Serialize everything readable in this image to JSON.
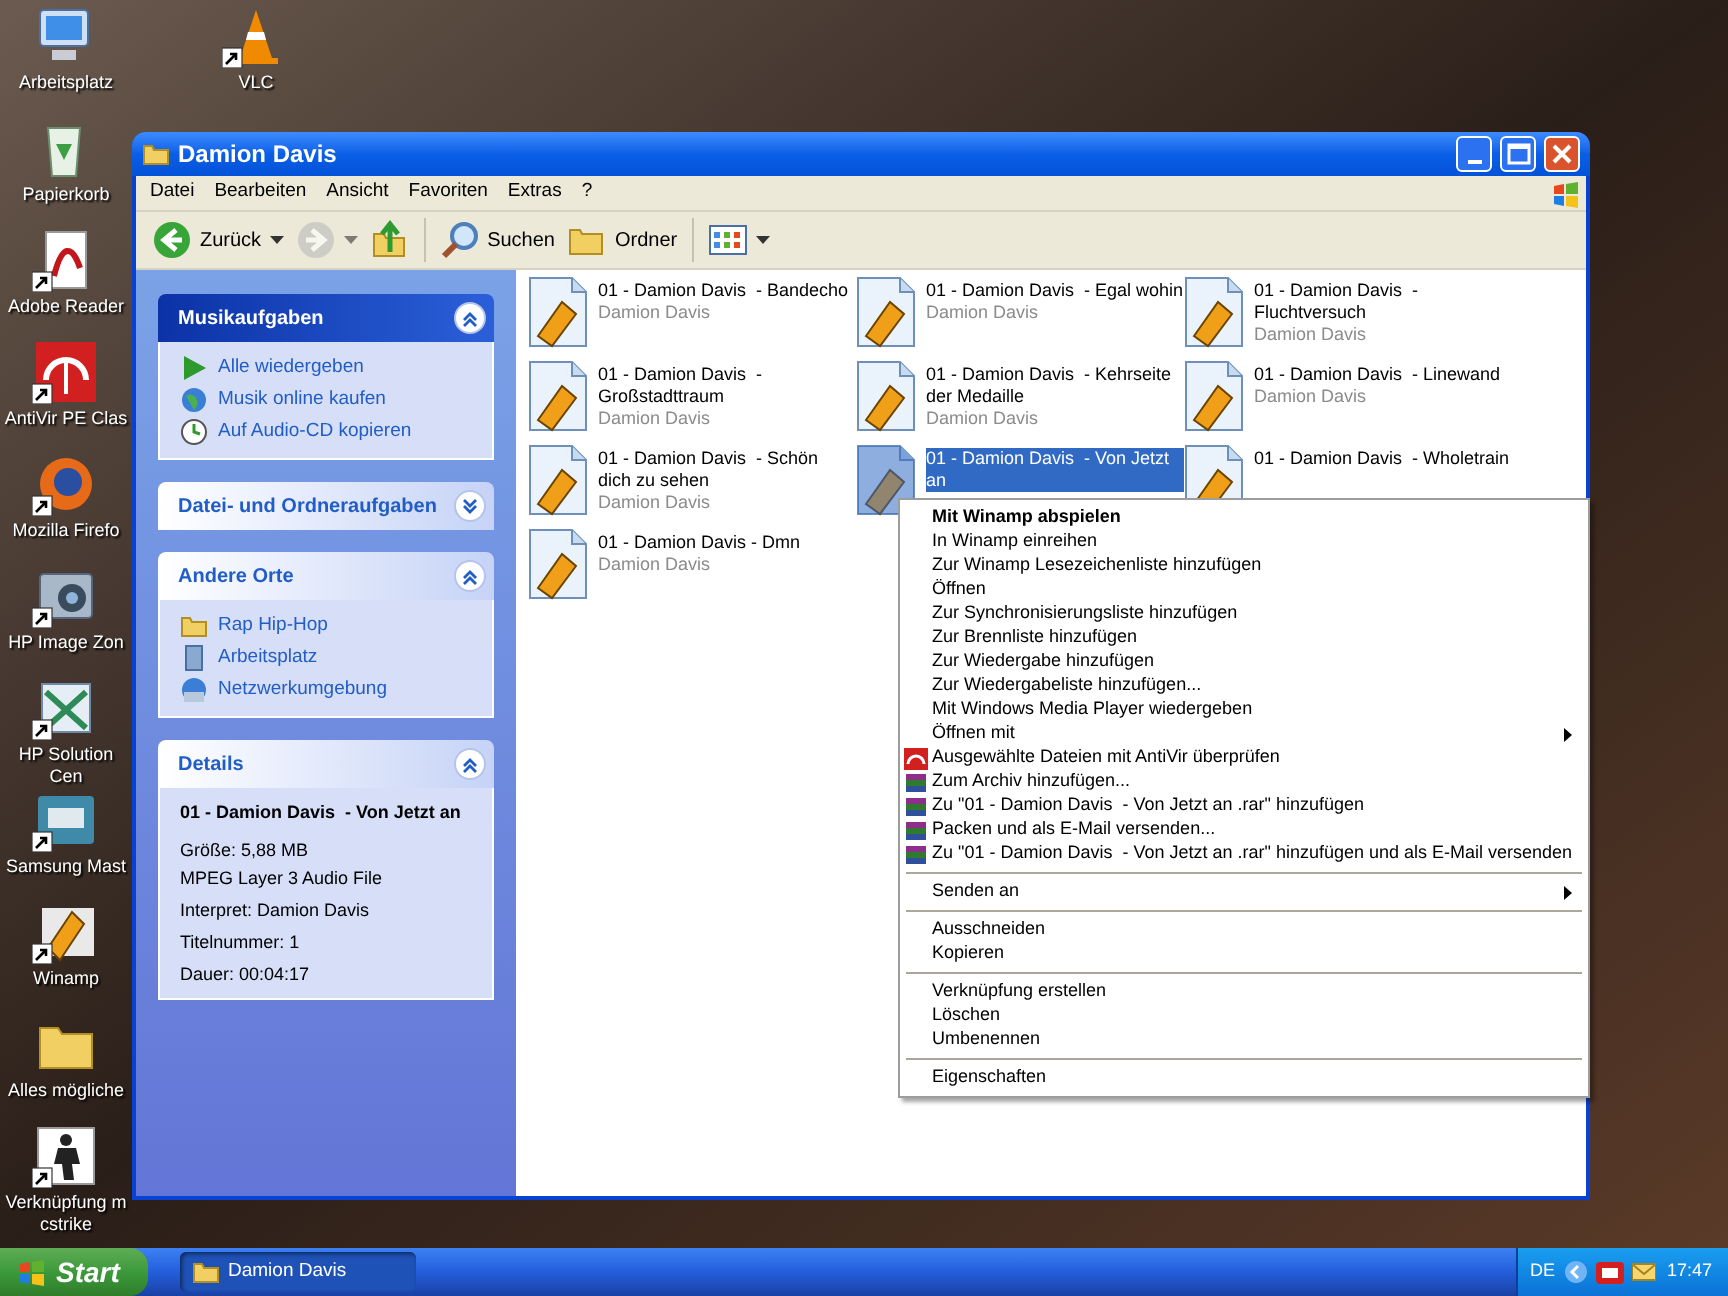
{
  "desktop": {
    "column_1": [
      {
        "label": "Arbeitsplatz",
        "kind": "computer",
        "shortcut": false
      },
      {
        "label": "Papierkorb",
        "kind": "recycle",
        "shortcut": false
      },
      {
        "label": "Adobe Reader",
        "kind": "pdf",
        "shortcut": true
      },
      {
        "label": "AntiVir PE Clas",
        "kind": "antivir",
        "shortcut": true
      },
      {
        "label": "Mozilla Firefo",
        "kind": "firefox",
        "shortcut": true
      },
      {
        "label": "HP Image Zon",
        "kind": "camera",
        "shortcut": true
      },
      {
        "label": "HP Solution Cen",
        "kind": "hp",
        "shortcut": true
      },
      {
        "label": "Samsung Mast",
        "kind": "samsung",
        "shortcut": true
      },
      {
        "label": "Winamp",
        "kind": "winamp",
        "shortcut": true
      },
      {
        "label": "Alles mögliche",
        "kind": "folder",
        "shortcut": false
      },
      {
        "label": "Verknüpfung m cstrike",
        "kind": "game",
        "shortcut": true
      }
    ],
    "column_2": [
      {
        "label": "VLC",
        "kind": "vlc",
        "shortcut": true
      }
    ]
  },
  "window": {
    "title": "Damion Davis",
    "menu": [
      "Datei",
      "Bearbeiten",
      "Ansicht",
      "Favoriten",
      "Extras",
      "?"
    ],
    "toolbar": [
      {
        "label": "Zurück",
        "kind": "back",
        "disabled": false
      },
      {
        "kind": "forward",
        "disabled": true
      },
      {
        "kind": "up",
        "disabled": false
      },
      {
        "label": "Suchen",
        "kind": "search",
        "disabled": false
      },
      {
        "label": "Ordner",
        "kind": "folders",
        "disabled": false
      },
      {
        "kind": "views",
        "disabled": false
      }
    ],
    "task_panels": [
      {
        "title": "Musikaufgaben",
        "kind": "special",
        "expanded": true,
        "links": [
          {
            "label": "Alle wiedergeben",
            "kind": "play"
          },
          {
            "label": "Musik online kaufen",
            "kind": "globe"
          },
          {
            "label": "Auf Audio-CD kopieren",
            "kind": "cd"
          }
        ]
      },
      {
        "title": "Datei- und Ordneraufgaben",
        "kind": "normal",
        "expanded": false
      },
      {
        "title": "Andere Orte",
        "kind": "normal",
        "expanded": true,
        "links": [
          {
            "label": "Rap Hip-Hop",
            "kind": "folder"
          },
          {
            "label": "Arbeitsplatz",
            "kind": "computer"
          },
          {
            "label": "Netzwerkumgebung",
            "kind": "network"
          }
        ]
      },
      {
        "title": "Details",
        "kind": "normal",
        "expanded": true,
        "details": {
          "name": "01 - Damion Davis  - Von Jetzt an",
          "lines": [
            "Größe: 5,88 MB",
            "MPEG Layer 3 Audio File",
            "Interpret: Damion Davis",
            "Titelnummer: 1",
            "Dauer: 00:04:17"
          ]
        }
      }
    ],
    "files": [
      {
        "name": "01 - Damion Davis  - Bandecho",
        "artist": "Damion Davis",
        "selected": false
      },
      {
        "name": "01 - Damion Davis  - Egal wohin",
        "artist": "Damion Davis",
        "selected": false
      },
      {
        "name": "01 - Damion Davis  - Fluchtversuch",
        "artist": "Damion Davis",
        "selected": false
      },
      {
        "name": "01 - Damion Davis  - Großstadttraum",
        "artist": "Damion Davis",
        "selected": false
      },
      {
        "name": "01 - Damion Davis  - Kehrseite der Medaille",
        "artist": "Damion Davis",
        "selected": false
      },
      {
        "name": "01 - Damion Davis  - Linewand",
        "artist": "Damion Davis",
        "selected": false
      },
      {
        "name": "01 - Damion Davis  - Schön dich zu sehen",
        "artist": "Damion Davis",
        "selected": false
      },
      {
        "name": "01 - Damion Davis  - Von Jetzt an",
        "selected": true
      },
      {
        "name": "01 - Damion Davis  - Wholetrain",
        "selected": false
      },
      {
        "name": "01 - Damion Davis - Dmn",
        "artist": "Damion Davis",
        "selected": false
      }
    ]
  },
  "context_menu": {
    "groups": [
      [
        {
          "label": "Mit Winamp abspielen",
          "kind": "default"
        },
        {
          "label": "In Winamp einreihen",
          "kind": "plain"
        },
        {
          "label": "Zur Winamp Lesezeichenliste hinzufügen",
          "kind": "plain"
        },
        {
          "label": "Öffnen",
          "kind": "plain"
        },
        {
          "label": "Zur Synchronisierungsliste hinzufügen",
          "kind": "plain"
        },
        {
          "label": "Zur Brennliste hinzufügen",
          "kind": "plain"
        },
        {
          "label": "Zur Wiedergabe hinzufügen",
          "kind": "plain"
        },
        {
          "label": "Zur Wiedergabeliste hinzufügen...",
          "kind": "plain"
        },
        {
          "label": "Mit Windows Media Player wiedergeben",
          "kind": "plain"
        },
        {
          "label": "Öffnen mit",
          "kind": "submenu"
        },
        {
          "label": "Ausgewählte Dateien mit AntiVir überprüfen",
          "kind": "scan"
        },
        {
          "label": "Zum Archiv hinzufügen...",
          "kind": "archive"
        },
        {
          "label": "Zu \"01 - Damion Davis  - Von Jetzt an .rar\" hinzufügen",
          "kind": "archive"
        },
        {
          "label": "Packen und als E-Mail versenden...",
          "kind": "archive"
        },
        {
          "label": "Zu \"01 - Damion Davis  - Von Jetzt an .rar\" hinzufügen und als E-Mail versenden",
          "kind": "archive"
        }
      ],
      [
        {
          "label": "Senden an",
          "kind": "submenu"
        }
      ],
      [
        {
          "label": "Ausschneiden",
          "kind": "plain"
        },
        {
          "label": "Kopieren",
          "kind": "plain"
        }
      ],
      [
        {
          "label": "Verknüpfung erstellen",
          "kind": "plain"
        },
        {
          "label": "Löschen",
          "kind": "plain"
        },
        {
          "label": "Umbenennen",
          "kind": "plain"
        }
      ],
      [
        {
          "label": "Eigenschaften",
          "kind": "plain"
        }
      ]
    ]
  },
  "taskbar": {
    "start": "Start",
    "tasks": [
      {
        "label": "Damion Davis",
        "selected": true
      }
    ],
    "tray": {
      "language": "DE",
      "clock": "17:47"
    }
  }
}
